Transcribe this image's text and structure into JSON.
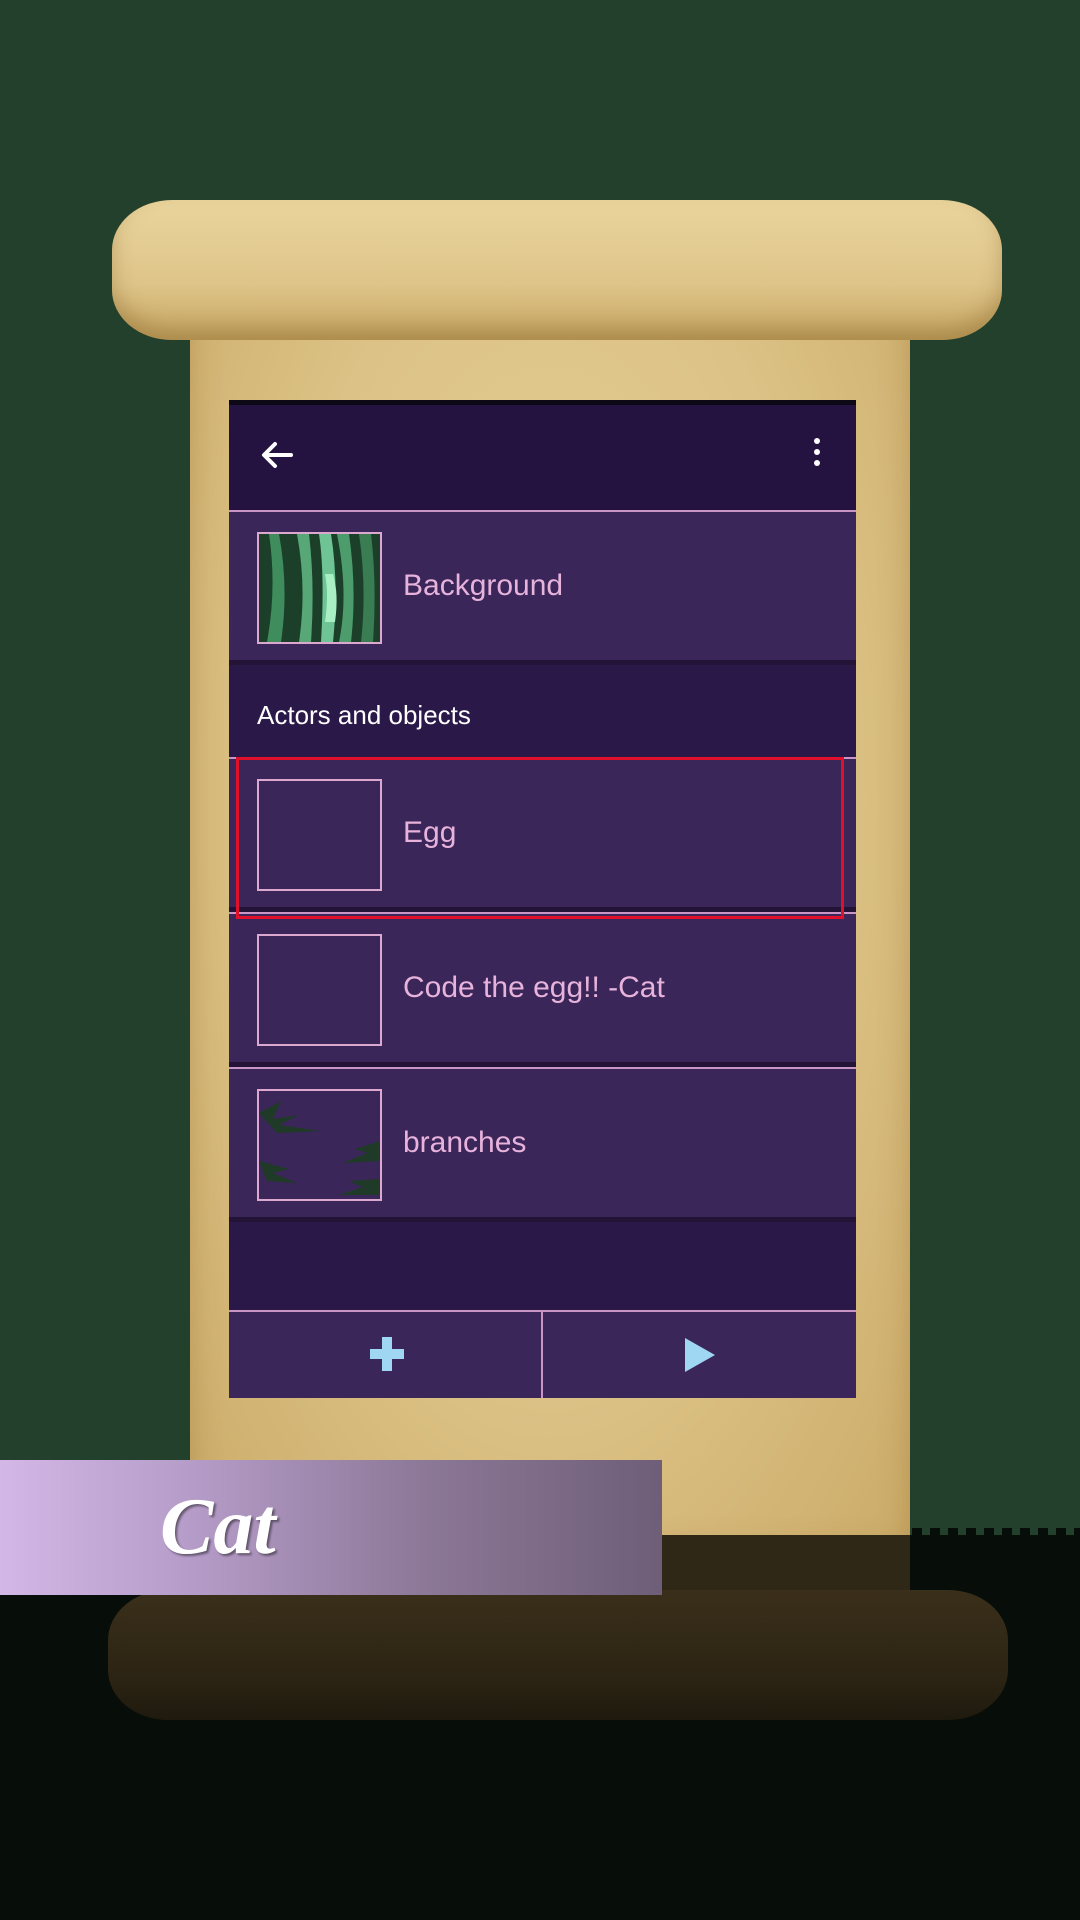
{
  "app": {
    "title_banner": "Cat"
  },
  "toolbar": {
    "back_icon": "arrow-left-icon",
    "more_icon": "more-vertical-icon"
  },
  "background_item": {
    "label": "Background",
    "thumb": "forest-background"
  },
  "section": {
    "header": "Actors and objects"
  },
  "actors": [
    {
      "label": "Egg",
      "thumb": "empty",
      "selected": true
    },
    {
      "label": "Code the egg!! -Cat",
      "thumb": "empty",
      "selected": false
    },
    {
      "label": "branches",
      "thumb": "branches",
      "selected": false
    }
  ],
  "bottom_bar": {
    "add_icon": "plus-icon",
    "play_icon": "play-icon"
  },
  "colors": {
    "app_bar": "#241340",
    "row_bg": "#3a2658",
    "label_text": "#e7b3dc",
    "accent_icon": "#9fd6f2",
    "selection_outline": "#e0102a"
  }
}
